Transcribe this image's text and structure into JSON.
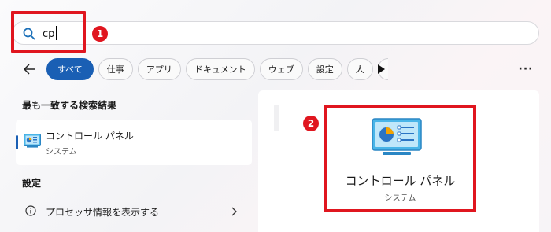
{
  "search": {
    "value": "cp"
  },
  "annotations": {
    "badge_1": "1",
    "badge_2": "2"
  },
  "filters": [
    {
      "label": "すべて",
      "active": true
    },
    {
      "label": "仕事",
      "active": false
    },
    {
      "label": "アプリ",
      "active": false
    },
    {
      "label": "ドキュメント",
      "active": false
    },
    {
      "label": "ウェブ",
      "active": false
    },
    {
      "label": "設定",
      "active": false
    },
    {
      "label": "人",
      "active": false
    }
  ],
  "best_match": {
    "heading": "最も一致する検索結果",
    "name": "コントロール パネル",
    "sub": "システム",
    "icon": "control-panel-icon"
  },
  "settings": {
    "heading": "設定",
    "items": [
      {
        "label": "プロセッサ情報を表示する",
        "icon": "info-icon"
      }
    ]
  },
  "preview": {
    "name": "コントロール パネル",
    "sub": "システム",
    "icon": "control-panel-icon"
  },
  "colors": {
    "accent": "#1a5fb4",
    "highlight": "#e0161f"
  }
}
